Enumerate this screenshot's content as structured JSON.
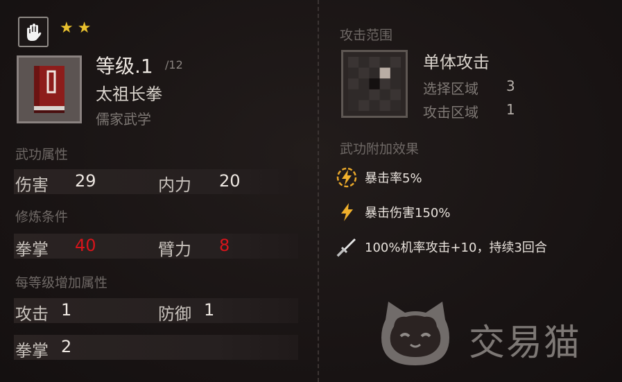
{
  "header": {
    "stars": 2,
    "level_label": "等级.1",
    "level_max": "/12",
    "skill_name": "太祖长拳",
    "school": "儒家武学"
  },
  "attributes": {
    "title": "武功属性",
    "rows": [
      {
        "l1": "伤害",
        "v1": "29",
        "l2": "内力",
        "v2": "20"
      }
    ]
  },
  "requirements": {
    "title": "修炼条件",
    "rows": [
      {
        "l1": "拳掌",
        "v1": "40",
        "l2": "臂力",
        "v2": "8"
      }
    ]
  },
  "per_level": {
    "title": "每等级增加属性",
    "rows": [
      {
        "l1": "攻击",
        "v1": "1",
        "l2": "防御",
        "v2": "1"
      },
      {
        "l1": "拳掌",
        "v1": "2"
      }
    ]
  },
  "attack_range": {
    "title": "攻击范围",
    "name": "单体攻击",
    "select_label": "选择区域",
    "select_value": "3",
    "attack_label": "攻击区域",
    "attack_value": "1"
  },
  "effects": {
    "title": "武功附加效果",
    "items": [
      {
        "icon": "lightning-circle-icon",
        "text": "暴击率5%"
      },
      {
        "icon": "lightning-icon",
        "text": "暴击伤害150%"
      },
      {
        "icon": "sword-icon",
        "text": "100%机率攻击+10，持续3回合"
      }
    ]
  },
  "watermark": {
    "text": "交易猫"
  },
  "colors": {
    "star": "#e8c02e",
    "requirement_red": "#d8141b",
    "lightning": "#e8a72a"
  }
}
